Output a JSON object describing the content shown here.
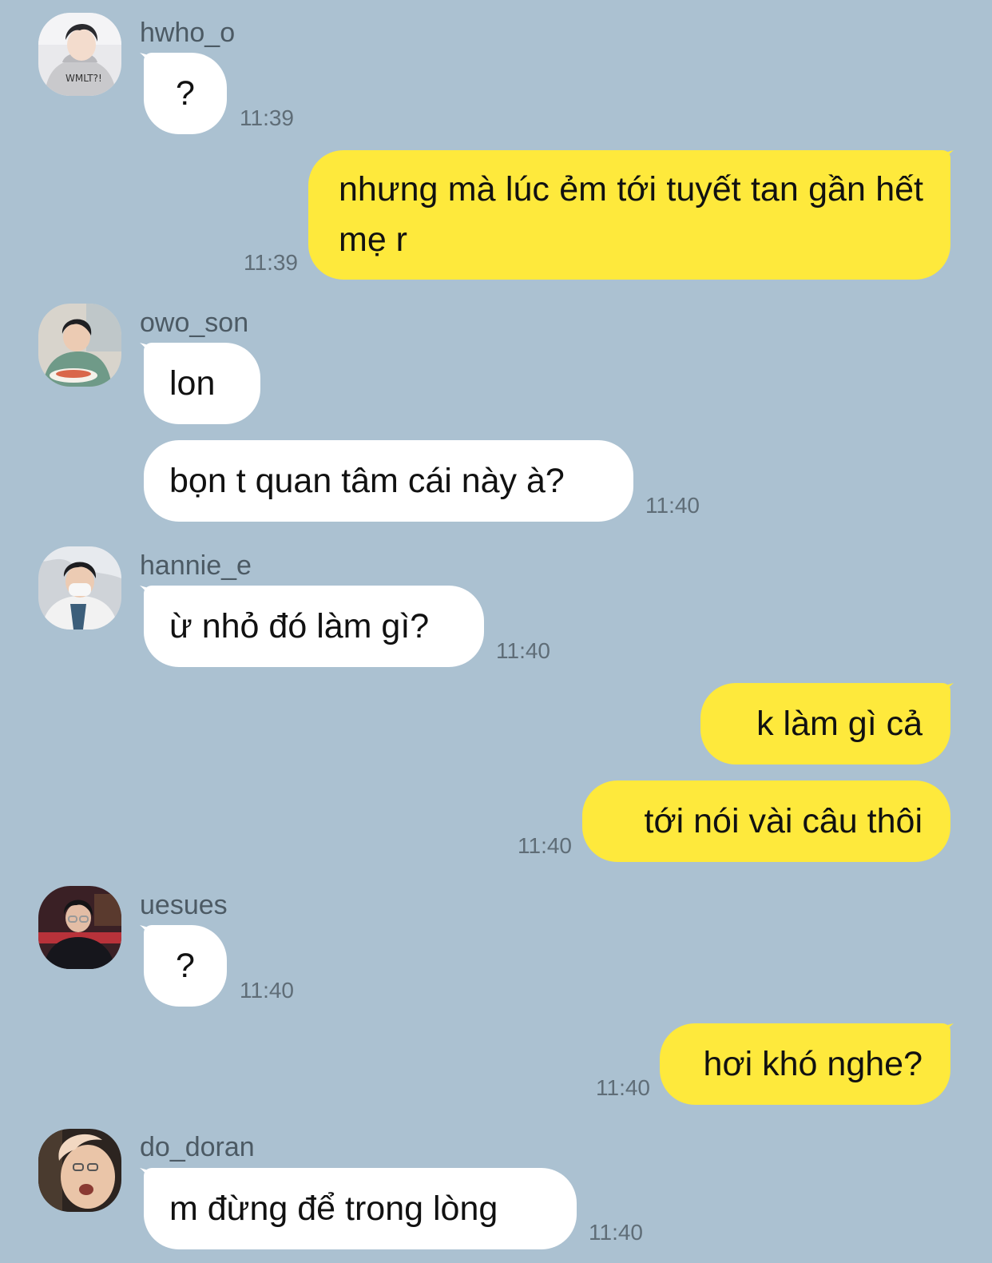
{
  "colors": {
    "background": "#abc1d1",
    "incoming_bubble": "#ffffff",
    "outgoing_bubble": "#fee93c",
    "username": "#4c5a64",
    "timestamp": "#5f6d77"
  },
  "messages": [
    {
      "sender": "hwho_o",
      "text": "?",
      "time": "11:39",
      "direction": "incoming"
    },
    {
      "sender": "me",
      "text": "nhưng mà lúc ẻm tới tuyết tan gần hết mẹ r",
      "time": "11:39",
      "direction": "outgoing"
    },
    {
      "sender": "owo_son",
      "text": "lon",
      "time": "",
      "direction": "incoming"
    },
    {
      "sender": "owo_son",
      "text": "bọn t quan tâm cái này à?",
      "time": "11:40",
      "direction": "incoming"
    },
    {
      "sender": "hannie_e",
      "text": "ừ nhỏ đó làm gì?",
      "time": "11:40",
      "direction": "incoming"
    },
    {
      "sender": "me",
      "text": "k làm gì cả",
      "time": "",
      "direction": "outgoing"
    },
    {
      "sender": "me",
      "text": "tới nói vài câu thôi",
      "time": "11:40",
      "direction": "outgoing"
    },
    {
      "sender": "uesues",
      "text": "?",
      "time": "11:40",
      "direction": "incoming"
    },
    {
      "sender": "me",
      "text": "hơi khó nghe?",
      "time": "11:40",
      "direction": "outgoing"
    },
    {
      "sender": "do_doran",
      "text": "m đừng để trong lòng",
      "time": "11:40",
      "direction": "incoming"
    }
  ]
}
